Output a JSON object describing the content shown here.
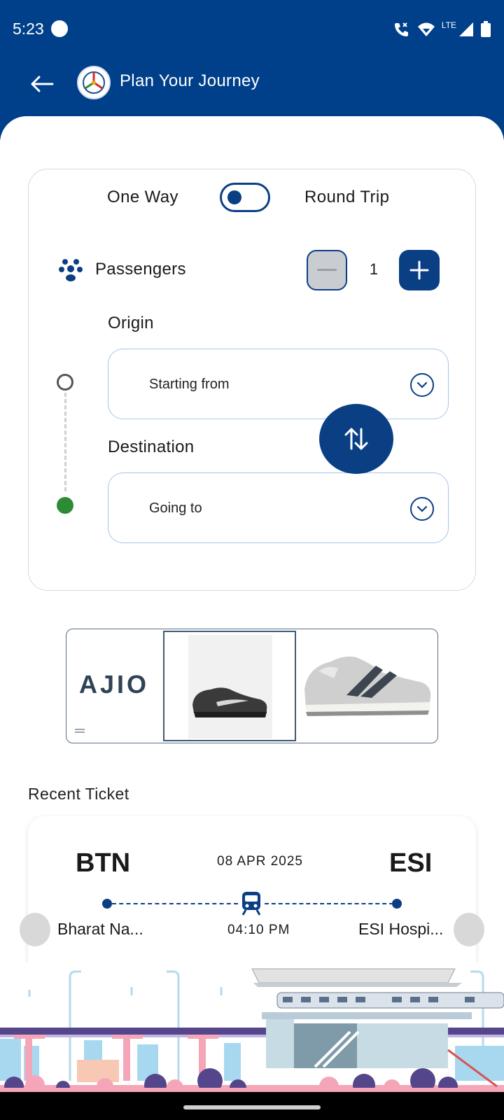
{
  "status_bar": {
    "time": "5:23",
    "network": "LTE"
  },
  "header": {
    "title": "Plan Your Journey"
  },
  "trip_toggle": {
    "left_label": "One Way",
    "right_label": "Round Trip",
    "selected": "One Way"
  },
  "passengers": {
    "label": "Passengers",
    "count": "1"
  },
  "origin": {
    "label": "Origin",
    "placeholder": "Starting from"
  },
  "destination": {
    "label": "Destination",
    "placeholder": "Going to"
  },
  "banner": {
    "brand": "AJIO"
  },
  "recent": {
    "title": "Recent Ticket",
    "ticket": {
      "from_code": "BTN",
      "to_code": "ESI",
      "date": "08 APR 2025",
      "time": "04:10 PM",
      "from_name": "Bharat Na...",
      "to_name": "ESI Hospi..."
    }
  },
  "colors": {
    "primary": "#003F8A",
    "accent": "#0A3F84",
    "destination_dot": "#2E8B35",
    "field_border": "#A9C4EE"
  },
  "icons": [
    "back-arrow-icon",
    "app-logo-icon",
    "passengers-icon",
    "minus-icon",
    "plus-icon",
    "chevron-down-icon",
    "swap-icon",
    "metro-train-icon"
  ]
}
